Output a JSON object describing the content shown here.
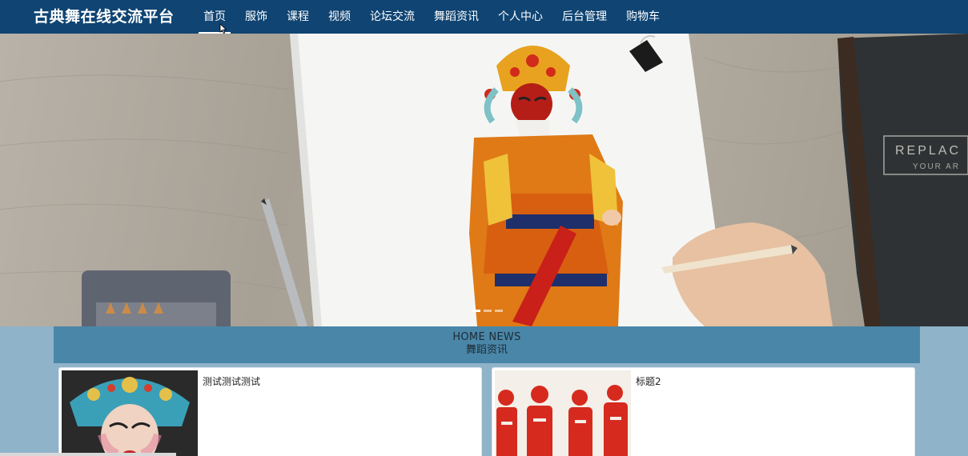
{
  "navbar": {
    "brand": "古典舞在线交流平台",
    "items": [
      {
        "label": "首页",
        "active": true
      },
      {
        "label": "服饰"
      },
      {
        "label": "课程"
      },
      {
        "label": "视频"
      },
      {
        "label": "论坛交流"
      },
      {
        "label": "舞蹈资讯"
      },
      {
        "label": "个人中心"
      },
      {
        "label": "后台管理"
      },
      {
        "label": "购物车"
      }
    ]
  },
  "hero": {
    "book_text_1": "REPLAC",
    "book_text_2": "YOUR AR",
    "slides": 3,
    "active_slide": 0
  },
  "news": {
    "title_en": "HOME NEWS",
    "title_cn": "舞蹈资讯",
    "cards": [
      {
        "title": "测试测试测试"
      },
      {
        "title": "标题2"
      }
    ]
  },
  "colors": {
    "navbar": "#0f4473",
    "page_bg": "#8fb3c9",
    "news_header": "#4a86a8"
  }
}
